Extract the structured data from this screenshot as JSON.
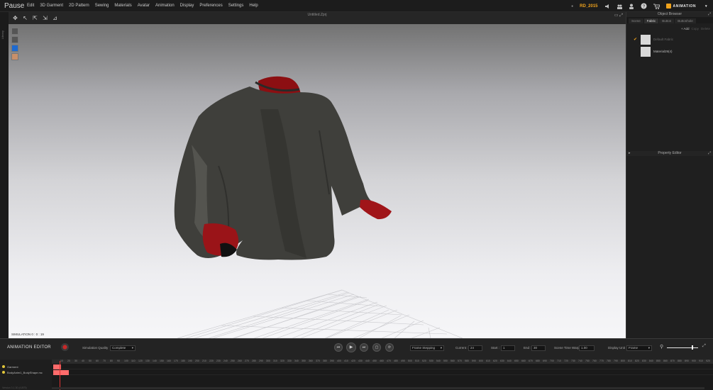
{
  "app": {
    "status_title": "Pause",
    "file_title": "Untitled.Zprj"
  },
  "menu": [
    "Edit",
    "3D Garment",
    "2D Pattern",
    "Sewing",
    "Materials",
    "Avatar",
    "Animation",
    "Display",
    "Preferences",
    "Settings",
    "Help"
  ],
  "topbar": {
    "user": "RD_2015",
    "mode": "ANIMATION",
    "icons": [
      "speaker-icon",
      "crowd-icon",
      "user-icon",
      "help-icon",
      "cart-icon"
    ],
    "accent": "#f0a31c"
  },
  "left_strip": {
    "label": "Library"
  },
  "viewport": {
    "sim_time": "SIMULATION 0 : 0 : 19",
    "toolbar_icons": [
      "select-mesh-icon",
      "fold-arrangement-icon",
      "move-icon",
      "fold-icon",
      "pin-icon"
    ],
    "side_icons": [
      "front-view-icon",
      "avatar-view-icon",
      "garment-color-icon",
      "avatar-display-icon"
    ]
  },
  "object_browser": {
    "title": "Object Browser",
    "tabs": [
      "Scene",
      "Fabric",
      "Button",
      "Buttonhole"
    ],
    "active_tab": "Fabric",
    "actions": [
      "+ Add",
      "Copy",
      "Delete"
    ],
    "fabrics": [
      {
        "name": "Default Fabric",
        "checked": true
      },
      {
        "name": "Material29(4)",
        "checked": false
      }
    ]
  },
  "property_editor": {
    "title": "Property Editor"
  },
  "animation_editor": {
    "title": "ANIMATION EDITOR",
    "sim_quality_label": "Simulation Quality",
    "sim_quality_value": "Complete",
    "frame_mode": "Frame Stepping",
    "current_label": "Current :",
    "current_value": "24",
    "start_label": "Start :",
    "start_value": "1",
    "end_label": "End :",
    "end_value": "30",
    "time_warp_label": "Scene Time Warp :",
    "time_warp_value": "1.00",
    "display_unit_label": "Display Unit",
    "display_unit_value": "Frame",
    "tracks": [
      "Garment",
      "BodyAnim1_BodyShape.mc"
    ],
    "version": "Version 3.1.30 (r1879)",
    "key_color": "#ff6b6b",
    "track_dot_color": "#e2c63a",
    "ruler_start": 10,
    "ruler_step": 10,
    "ruler_count": 93
  }
}
